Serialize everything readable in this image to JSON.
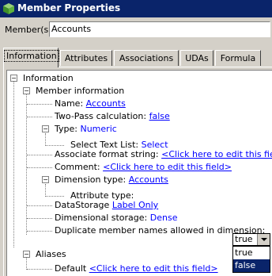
{
  "window": {
    "title": "Member Properties",
    "title_bar_color": "#0a246a"
  },
  "member": {
    "label": "Member(s):",
    "value": "Accounts"
  },
  "tabs": [
    {
      "label": "Information",
      "active": true
    },
    {
      "label": "Attributes",
      "active": false
    },
    {
      "label": "Associations",
      "active": false
    },
    {
      "label": "UDAs",
      "active": false
    },
    {
      "label": "Formula",
      "active": false
    }
  ],
  "tree": {
    "root": "Information",
    "member_information": "Member information",
    "name_label": "Name:",
    "name_value": "Accounts",
    "two_pass_label": "Two-Pass calculation:",
    "two_pass_value": "false",
    "type_label": "Type:",
    "type_value": "Numeric",
    "select_text_list_label": "Select Text List:",
    "select_text_list_value": "Select",
    "assoc_format_label": "Associate format string:",
    "assoc_format_value": "<Click here to edit this field>",
    "comment_label": "Comment:",
    "comment_value": "<Click here to edit this field>",
    "dim_type_label": "Dimension type:",
    "dim_type_value": "Accounts",
    "attribute_type_label": "Attribute type:",
    "data_storage_label": "DataStorage",
    "data_storage_value": "Label Only",
    "dim_storage_label": "Dimensional storage:",
    "dim_storage_value": "Dense",
    "duplicate_label": "Duplicate member names allowed in dimension:",
    "duplicate_value": "true",
    "aliases": "Aliases",
    "default_label": "Default",
    "default_value": "<Click here to edit this field>"
  },
  "dropdown": {
    "options": [
      "true",
      "false"
    ],
    "highlighted": "false"
  },
  "colors": {
    "link": "#0000ff",
    "selection": "#0a246a",
    "face": "#d4d0c8"
  }
}
